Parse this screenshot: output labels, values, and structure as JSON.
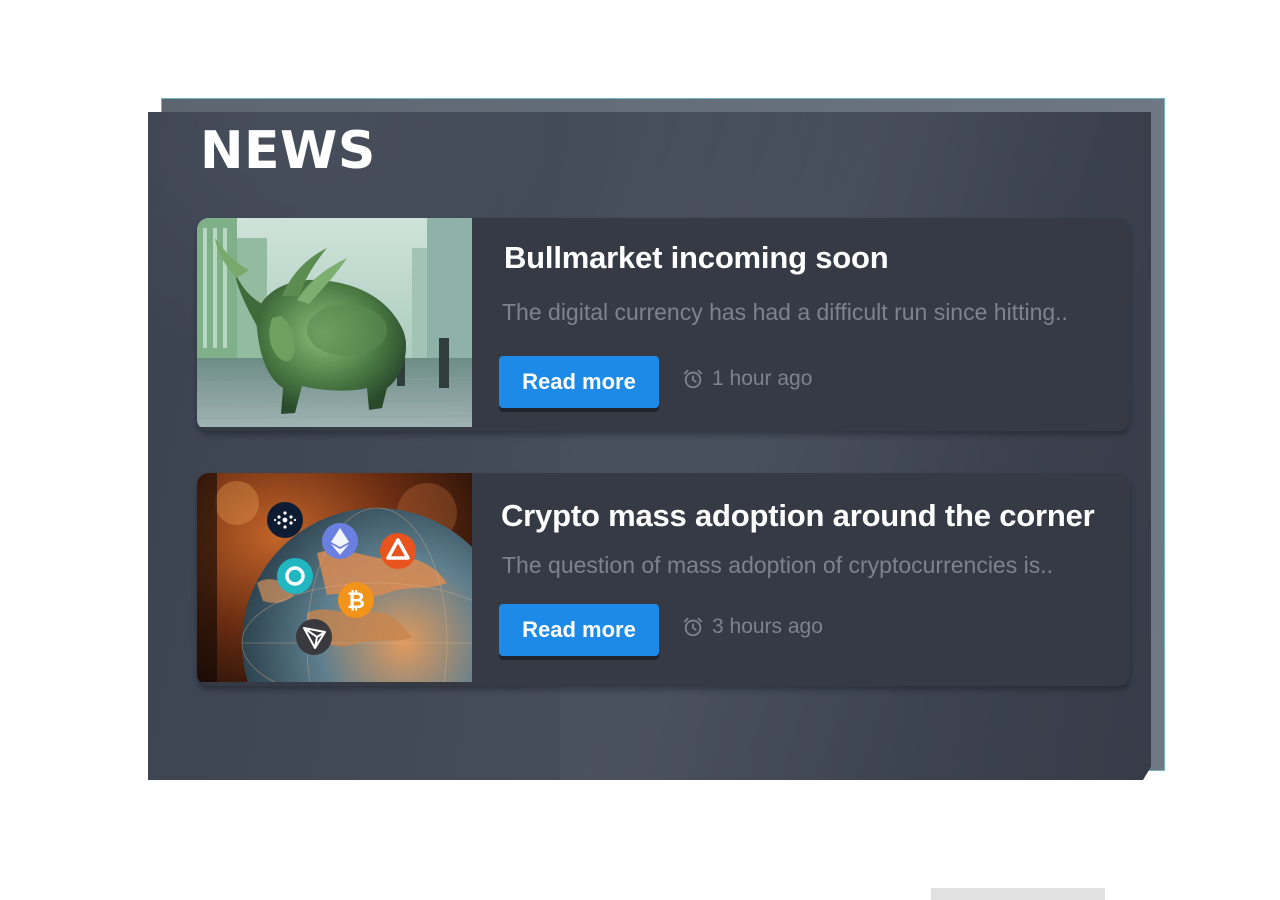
{
  "title": "NEWS",
  "articles": [
    {
      "headline": "Bullmarket incoming soon",
      "excerpt": "The digital currency has had a difficult run since hitting..",
      "button_label": "Read more",
      "time": "1 hour ago",
      "image_icon": "charging-bull-statue-photo"
    },
    {
      "headline": "Crypto mass adoption around the corner",
      "excerpt": "The question of mass adoption of cryptocurrencies is..",
      "button_label": "Read more",
      "time": "3 hours ago",
      "image_icon": "globe-with-crypto-coins-photo"
    }
  ],
  "colors": {
    "accent": "#1c8ae6",
    "card": "#353a45",
    "panel": "#424a57",
    "muted_text": "#7d838e"
  }
}
